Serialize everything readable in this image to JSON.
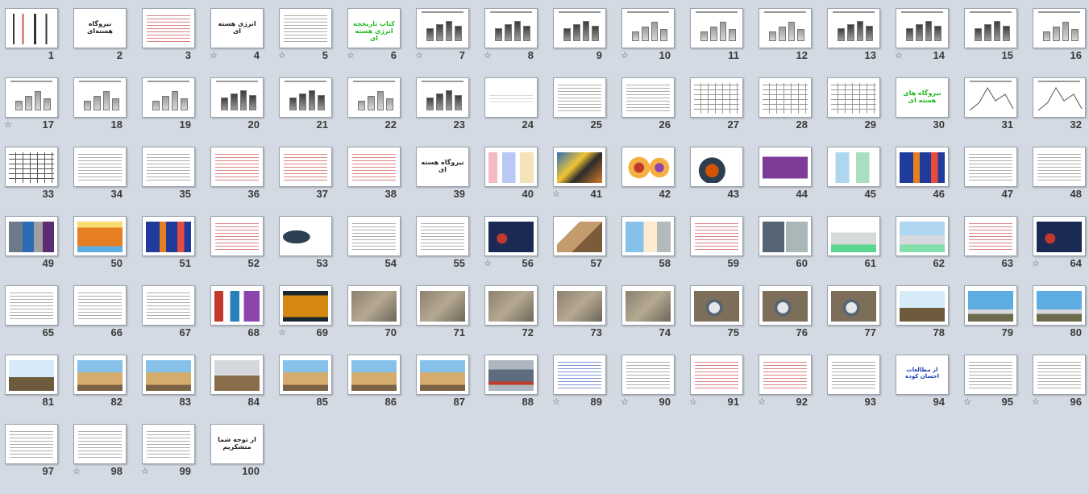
{
  "slides": [
    {
      "n": "1",
      "kind": "logo"
    },
    {
      "n": "2",
      "kind": "title",
      "title": "نیروگاه هسته‌ای"
    },
    {
      "n": "3",
      "kind": "text-red"
    },
    {
      "n": "4",
      "kind": "title",
      "title": "انرژی هسته ای",
      "star": true
    },
    {
      "n": "5",
      "kind": "text",
      "star": true
    },
    {
      "n": "6",
      "kind": "title-green",
      "title": "کتاب تاریخچه انرژی هسته ای",
      "star": true
    },
    {
      "n": "7",
      "kind": "bars-dark",
      "star": true
    },
    {
      "n": "8",
      "kind": "bars-dark",
      "star": true
    },
    {
      "n": "9",
      "kind": "bars-dark"
    },
    {
      "n": "10",
      "kind": "bars",
      "star": true
    },
    {
      "n": "11",
      "kind": "bars"
    },
    {
      "n": "12",
      "kind": "bars"
    },
    {
      "n": "13",
      "kind": "bars-dark"
    },
    {
      "n": "14",
      "kind": "bars-dark",
      "star": true
    },
    {
      "n": "15",
      "kind": "bars-dark"
    },
    {
      "n": "16",
      "kind": "bars"
    },
    {
      "n": "17",
      "kind": "bars",
      "star": true
    },
    {
      "n": "18",
      "kind": "bars"
    },
    {
      "n": "19",
      "kind": "bars"
    },
    {
      "n": "20",
      "kind": "bars-dark"
    },
    {
      "n": "21",
      "kind": "bars-dark"
    },
    {
      "n": "22",
      "kind": "bars"
    },
    {
      "n": "23",
      "kind": "bars-dark"
    },
    {
      "n": "24",
      "kind": "text-light"
    },
    {
      "n": "25",
      "kind": "text"
    },
    {
      "n": "26",
      "kind": "text"
    },
    {
      "n": "27",
      "kind": "table"
    },
    {
      "n": "28",
      "kind": "table"
    },
    {
      "n": "29",
      "kind": "table"
    },
    {
      "n": "30",
      "kind": "title-green",
      "title": "نیروگاه های هسته ای"
    },
    {
      "n": "31",
      "kind": "chart-line"
    },
    {
      "n": "32",
      "kind": "chart-line"
    },
    {
      "n": "33",
      "kind": "table-dark"
    },
    {
      "n": "34",
      "kind": "text"
    },
    {
      "n": "35",
      "kind": "text"
    },
    {
      "n": "36",
      "kind": "text-red"
    },
    {
      "n": "37",
      "kind": "text-red"
    },
    {
      "n": "38",
      "kind": "text-red"
    },
    {
      "n": "39",
      "kind": "title",
      "title": "نیروگاه هسته ای"
    },
    {
      "n": "40",
      "kind": "image",
      "img": "periodic"
    },
    {
      "n": "41",
      "kind": "image",
      "img": "collage",
      "star": true
    },
    {
      "n": "42",
      "kind": "image",
      "img": "atoms"
    },
    {
      "n": "43",
      "kind": "image",
      "img": "fission"
    },
    {
      "n": "44",
      "kind": "image",
      "img": "diagram-purple"
    },
    {
      "n": "45",
      "kind": "image",
      "img": "diagram-light"
    },
    {
      "n": "46",
      "kind": "image",
      "img": "diagram-blue"
    },
    {
      "n": "47",
      "kind": "text"
    },
    {
      "n": "48",
      "kind": "text"
    },
    {
      "n": "49",
      "kind": "image",
      "img": "reactors"
    },
    {
      "n": "50",
      "kind": "image",
      "img": "core"
    },
    {
      "n": "51",
      "kind": "image",
      "img": "diagram-blue"
    },
    {
      "n": "52",
      "kind": "text-red"
    },
    {
      "n": "53",
      "kind": "image",
      "img": "vessel"
    },
    {
      "n": "54",
      "kind": "text"
    },
    {
      "n": "55",
      "kind": "text"
    },
    {
      "n": "56",
      "kind": "image",
      "img": "dark-diagram",
      "star": true
    },
    {
      "n": "57",
      "kind": "image",
      "img": "collage2"
    },
    {
      "n": "58",
      "kind": "image",
      "img": "collage3"
    },
    {
      "n": "59",
      "kind": "text-red"
    },
    {
      "n": "60",
      "kind": "image",
      "img": "towers"
    },
    {
      "n": "61",
      "kind": "image",
      "img": "cooling"
    },
    {
      "n": "62",
      "kind": "image",
      "img": "plant"
    },
    {
      "n": "63",
      "kind": "text-red"
    },
    {
      "n": "64",
      "kind": "image",
      "img": "dark-diagram",
      "star": true
    },
    {
      "n": "65",
      "kind": "text"
    },
    {
      "n": "66",
      "kind": "text"
    },
    {
      "n": "67",
      "kind": "text"
    },
    {
      "n": "68",
      "kind": "image",
      "img": "schematic"
    },
    {
      "n": "69",
      "kind": "image",
      "img": "map",
      "star": true
    },
    {
      "n": "70",
      "kind": "image",
      "img": "aerial"
    },
    {
      "n": "71",
      "kind": "image",
      "img": "aerial"
    },
    {
      "n": "72",
      "kind": "image",
      "img": "aerial"
    },
    {
      "n": "73",
      "kind": "image",
      "img": "aerial"
    },
    {
      "n": "74",
      "kind": "image",
      "img": "aerial"
    },
    {
      "n": "75",
      "kind": "image",
      "img": "dome"
    },
    {
      "n": "76",
      "kind": "image",
      "img": "dome"
    },
    {
      "n": "77",
      "kind": "image",
      "img": "dome"
    },
    {
      "n": "78",
      "kind": "image",
      "img": "field"
    },
    {
      "n": "79",
      "kind": "image",
      "img": "sky"
    },
    {
      "n": "80",
      "kind": "image",
      "img": "sky"
    },
    {
      "n": "81",
      "kind": "image",
      "img": "field"
    },
    {
      "n": "82",
      "kind": "image",
      "img": "building"
    },
    {
      "n": "83",
      "kind": "image",
      "img": "building"
    },
    {
      "n": "84",
      "kind": "image",
      "img": "dome-close"
    },
    {
      "n": "85",
      "kind": "image",
      "img": "building"
    },
    {
      "n": "86",
      "kind": "image",
      "img": "building"
    },
    {
      "n": "87",
      "kind": "image",
      "img": "building"
    },
    {
      "n": "88",
      "kind": "image",
      "img": "machine"
    },
    {
      "n": "89",
      "kind": "text-blue",
      "star": true
    },
    {
      "n": "90",
      "kind": "text",
      "star": true
    },
    {
      "n": "91",
      "kind": "text-red",
      "star": true
    },
    {
      "n": "92",
      "kind": "text-red",
      "star": true
    },
    {
      "n": "93",
      "kind": "text"
    },
    {
      "n": "94",
      "kind": "title-blue",
      "title": "از مطالعات احسان کوده"
    },
    {
      "n": "95",
      "kind": "text",
      "star": true
    },
    {
      "n": "96",
      "kind": "text",
      "star": true
    },
    {
      "n": "97",
      "kind": "text"
    },
    {
      "n": "98",
      "kind": "text",
      "star": true
    },
    {
      "n": "99",
      "kind": "text",
      "star": true
    },
    {
      "n": "100",
      "kind": "title",
      "title": "از توجه شما متشکریم"
    }
  ],
  "colors": {
    "background": "#d4dae3",
    "number": "#3a3a3a"
  },
  "icons": {
    "transition": "star-icon"
  }
}
